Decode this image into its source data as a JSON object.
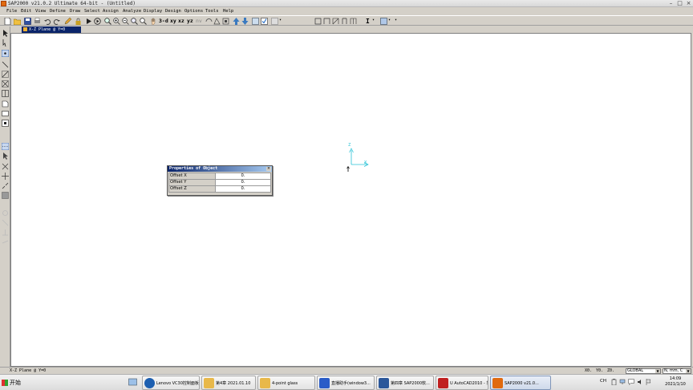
{
  "window": {
    "title": "SAP2000 v21.0.2 Ultimate 64-bit - (Untitled)"
  },
  "menu": [
    "File",
    "Edit",
    "View",
    "Define",
    "Draw",
    "Select",
    "Assign",
    "Analyze",
    "Display",
    "Design",
    "Options",
    "Tools",
    "Help"
  ],
  "toolbar": {
    "label_3d": "3-d",
    "label_xy": "xy",
    "label_xz": "xz",
    "label_yz": "yz",
    "label_nv": "nv"
  },
  "view_tab": {
    "title": "X-Z Plane @ Y=0"
  },
  "axes": {
    "z_label": "Z",
    "x_label": "X"
  },
  "dialog": {
    "title": "Properties of Object",
    "rows": [
      {
        "label": "Offset X",
        "value": "0."
      },
      {
        "label": "Offset Y",
        "value": "0."
      },
      {
        "label": "Offset Z",
        "value": "0."
      }
    ]
  },
  "status": {
    "left_text": "X-Z Plane @ Y=0",
    "x_coord": "X0.",
    "y_coord": "Y0.",
    "z_coord": "Z0.",
    "coord_system": "GLOBAL",
    "units": "N, mm, C"
  },
  "taskbar": {
    "start_label": "开始",
    "items": [
      {
        "label": "Lenovo VC30控制面板",
        "icon": "lenovo-icon",
        "color": "#1d5fb0"
      },
      {
        "label": "第4章 2021.01.10",
        "icon": "folder-icon",
        "color": "#e8b84a"
      },
      {
        "label": "4-point glass",
        "icon": "folder-icon",
        "color": "#e8b84a"
      },
      {
        "label": "直播助手(window3...",
        "icon": "stream-icon",
        "color": "#2a5cc8"
      },
      {
        "label": "第四章 SAP2000软...",
        "icon": "word-icon",
        "color": "#2b579a"
      },
      {
        "label": "U AutoCAD2010 - 简...",
        "icon": "autocad-icon",
        "color": "#c02020"
      },
      {
        "label": "SAP2000 v21.0...",
        "icon": "sap-icon",
        "color": "#e06a10"
      }
    ],
    "tray_lang": "CH",
    "clock_time": "14:09",
    "clock_date": "2021/1/10"
  }
}
